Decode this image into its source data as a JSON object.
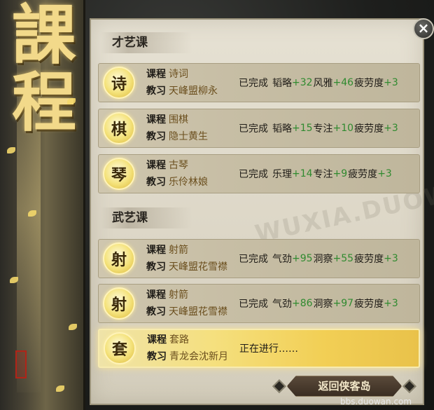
{
  "scroll_title": [
    "課",
    "程"
  ],
  "close_label": "×",
  "sections": [
    {
      "title": "才艺课"
    },
    {
      "title": "武艺课"
    }
  ],
  "course_label": "课程",
  "teacher_label": "教习",
  "rows": [
    {
      "medal": "诗",
      "course": "诗词",
      "teacher": "天峰盟柳永",
      "status": "已完成",
      "stats": [
        {
          "name": "韬略",
          "plus": "+32"
        },
        {
          "name": "风雅",
          "plus": "+46"
        },
        {
          "name": "疲劳度",
          "plus": "+3"
        }
      ]
    },
    {
      "medal": "棋",
      "course": "围棋",
      "teacher": "隐士黄生",
      "status": "已完成",
      "stats": [
        {
          "name": "韬略",
          "plus": "+15"
        },
        {
          "name": "专注",
          "plus": "+10"
        },
        {
          "name": "疲劳度",
          "plus": "+3"
        }
      ]
    },
    {
      "medal": "琴",
      "course": "古琴",
      "teacher": "乐伶林娘",
      "status": "已完成",
      "stats": [
        {
          "name": "乐理",
          "plus": "+14"
        },
        {
          "name": "专注",
          "plus": "+9"
        },
        {
          "name": "疲劳度",
          "plus": "+3"
        }
      ]
    },
    {
      "medal": "射",
      "course": "射箭",
      "teacher": "天峰盟花雪襟",
      "status": "已完成",
      "stats": [
        {
          "name": "气劲",
          "plus": "+95"
        },
        {
          "name": "洞察",
          "plus": "+55"
        },
        {
          "name": "疲劳度",
          "plus": "+3"
        }
      ]
    },
    {
      "medal": "射",
      "course": "射箭",
      "teacher": "天峰盟花雪襟",
      "status": "已完成",
      "stats": [
        {
          "name": "气劲",
          "plus": "+86"
        },
        {
          "name": "洞察",
          "plus": "+97"
        },
        {
          "name": "疲劳度",
          "plus": "+3"
        }
      ]
    },
    {
      "medal": "套",
      "course": "套路",
      "teacher": "青龙会沈新月",
      "status": "正在进行……",
      "stats": []
    }
  ],
  "return_button": "返回侠客岛",
  "watermark_text": "bbs.duowan.com",
  "faint_watermark": "WUXIA.DUOWAN.COM",
  "colors": {
    "plus": "#2f8a2f",
    "active_row": "#f5e07f",
    "panel": "#e6e1d3"
  }
}
